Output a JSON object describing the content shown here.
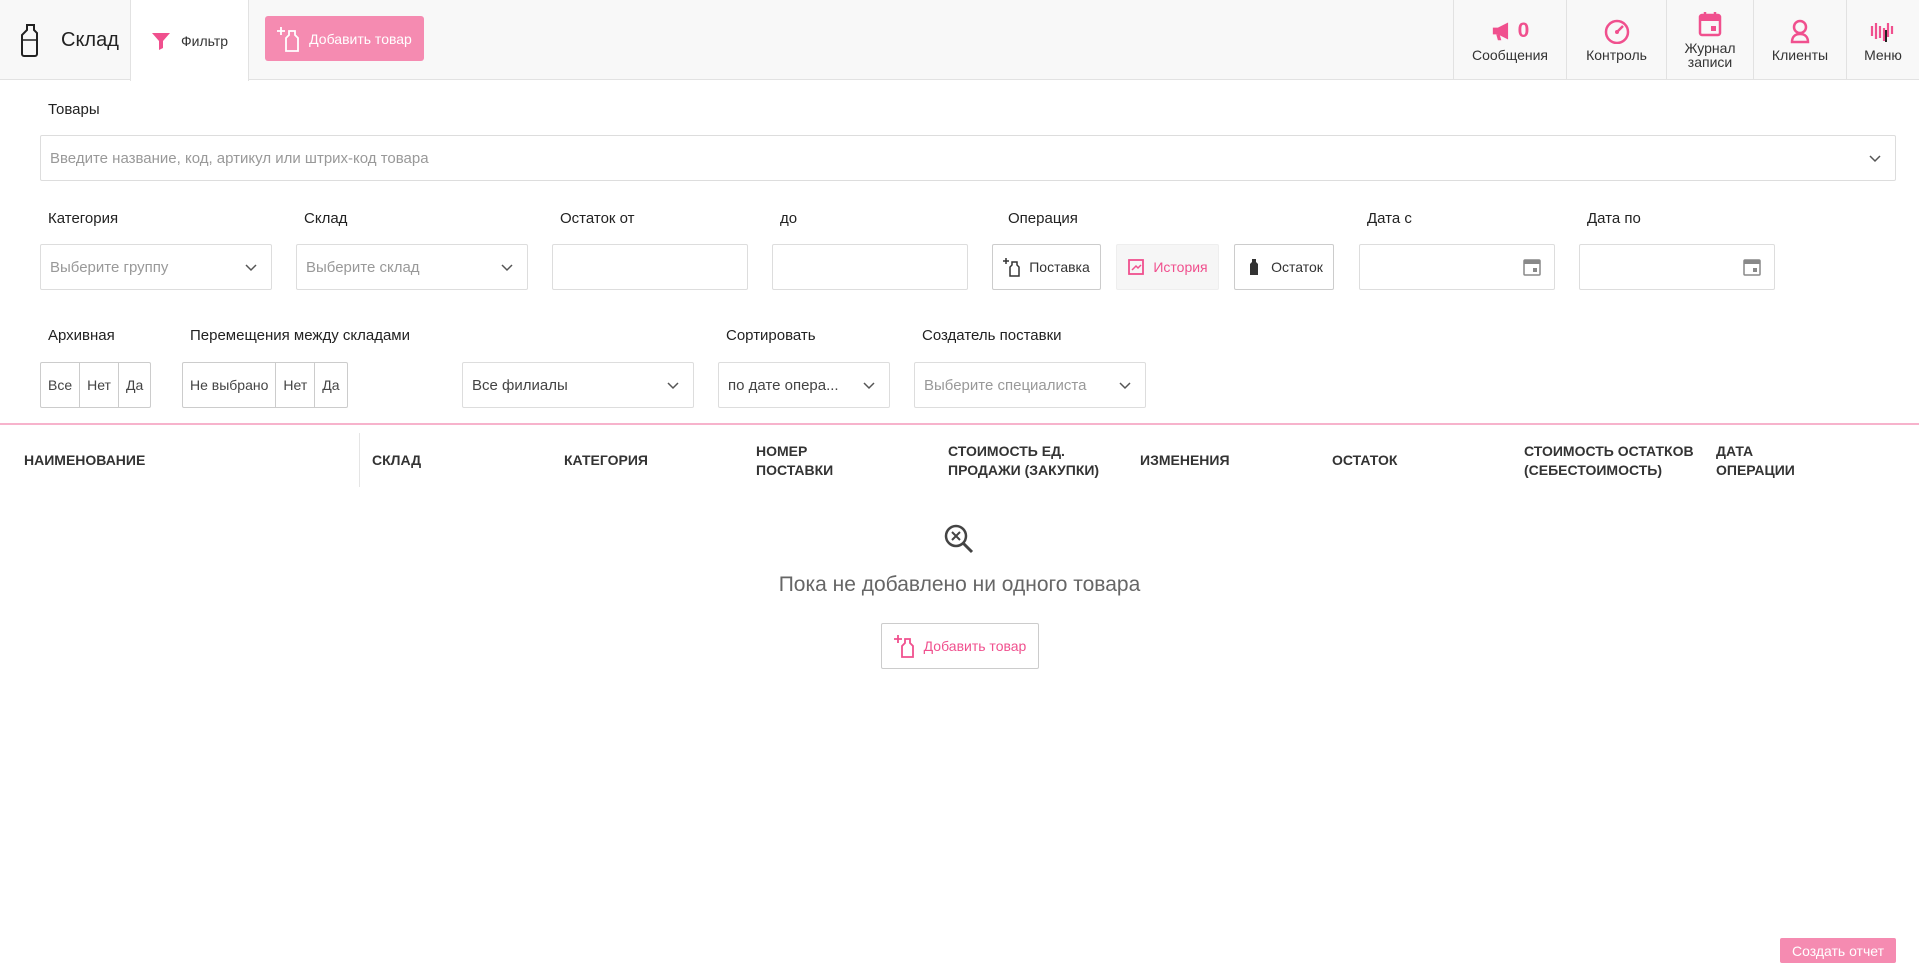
{
  "header": {
    "title": "Склад",
    "filter_label": "Фильтр",
    "add_product": "Добавить товар",
    "nav": {
      "messages_count": "0",
      "messages": "Сообщения",
      "control": "Контроль",
      "journal_line1": "Журнал",
      "journal_line2": "записи",
      "clients": "Клиенты",
      "menu": "Меню"
    }
  },
  "filters": {
    "products_label": "Товары",
    "products_placeholder": "Введите название, код, артикул или штрих-код товара",
    "category_label": "Категория",
    "category_placeholder": "Выберите группу",
    "warehouse_label": "Склад",
    "warehouse_placeholder": "Выберите склад",
    "stock_from_label": "Остаток от",
    "stock_to_label": "до",
    "operation_label": "Операция",
    "operations": [
      "Поставка",
      "История",
      "Остаток"
    ],
    "date_from_label": "Дата с",
    "date_to_label": "Дата по",
    "archive_label": "Архивная",
    "archive_options": [
      "Все",
      "Нет",
      "Да"
    ],
    "transfers_label": "Перемещения между складами",
    "transfers_options": [
      "Не выбрано",
      "Нет",
      "Да"
    ],
    "branches_value": "Все филиалы",
    "sort_label": "Сортировать",
    "sort_value": "по дате опера...",
    "creator_label": "Создатель поставки",
    "creator_placeholder": "Выберите специалиста"
  },
  "table": {
    "columns": [
      [
        "НАИМЕНОВАНИЕ"
      ],
      [
        "СКЛАД"
      ],
      [
        "КАТЕГОРИЯ"
      ],
      [
        "НОМЕР",
        "ПОСТАВКИ"
      ],
      [
        "СТОИМОСТЬ ЕД.",
        "ПРОДАЖИ (ЗАКУПКИ)"
      ],
      [
        "ИЗМЕНЕНИЯ"
      ],
      [
        "ОСТАТОК"
      ],
      [
        "СТОИМОСТЬ ОСТАТКОВ",
        "(СЕБЕСТОИМОСТЬ)"
      ],
      [
        "ДАТА",
        "ОПЕРАЦИИ"
      ]
    ]
  },
  "empty_state": {
    "text": "Пока не добавлено ни одного товара",
    "button": "Добавить товар"
  },
  "report_button": "Создать отчет",
  "colors": {
    "accent": "#f0508e",
    "accent_light": "#f58bb1"
  }
}
